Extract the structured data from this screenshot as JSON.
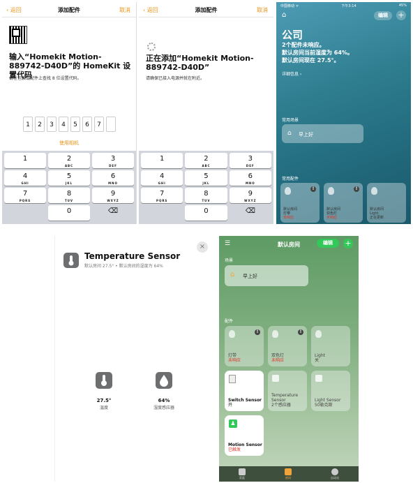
{
  "panel1": {
    "nav": {
      "back": "返回",
      "title": "添加配件",
      "cancel": "取消"
    },
    "heading": "输入“Homekit Motion-889742-D40D”的 HomeKit 设置代码",
    "hint": "请在包装或配件上查找 8 位设置代码。",
    "code_digits": [
      "1",
      "2",
      "3",
      "4",
      "5",
      "6",
      "7",
      ""
    ],
    "use_camera": "使用相机"
  },
  "panel2": {
    "nav": {
      "back": "返回",
      "title": "添加配件",
      "cancel": "取消"
    },
    "heading": "正在添加“Homekit Motion-889742-D40D”",
    "hint": "请确保已接入电源并就在附近。"
  },
  "keyboard": {
    "keys": [
      {
        "d": "1",
        "l": ""
      },
      {
        "d": "2",
        "l": "ABC"
      },
      {
        "d": "3",
        "l": "DEF"
      },
      {
        "d": "4",
        "l": "GHI"
      },
      {
        "d": "5",
        "l": "JKL"
      },
      {
        "d": "6",
        "l": "MNO"
      },
      {
        "d": "7",
        "l": "PQRS"
      },
      {
        "d": "8",
        "l": "TUV"
      },
      {
        "d": "9",
        "l": "WXYZ"
      },
      {
        "d": "",
        "l": ""
      },
      {
        "d": "0",
        "l": ""
      },
      {
        "d": "⌫",
        "l": ""
      }
    ]
  },
  "panel3": {
    "status": {
      "carrier": "中国移动 ᯤ",
      "time": "下午3:14",
      "battery": "45%"
    },
    "edit": "编辑",
    "home_name": "公司",
    "summary": [
      "2个配件未响应。",
      "默认房间当前湿度为 64%。",
      "默认房间现在 27.5°。"
    ],
    "details": "详细信息 ›",
    "scenes_label": "常用场景",
    "scene": "早上好",
    "accessories_label": "常用配件",
    "accessories": [
      {
        "room": "默认房间",
        "name": "灯带",
        "status": "未响应"
      },
      {
        "room": "默认房间",
        "name": "双色灯",
        "status": "未响应"
      },
      {
        "room": "默认房间",
        "name": "Light",
        "status": "正在更新"
      }
    ]
  },
  "panel4": {
    "title": "Temperature Sensor",
    "subtitle": "默认房间 27.5° • 默认房间的湿度为 64%",
    "readings": [
      {
        "value": "27.5°",
        "label": "温度"
      },
      {
        "value": "64%",
        "label": "湿度感应器"
      }
    ]
  },
  "panel5": {
    "title": "默认房间",
    "edit": "编辑",
    "scenes_label": "场景",
    "scene": "早上好",
    "accessories_label": "配件",
    "tiles": [
      {
        "name": "灯带",
        "status": "未响应"
      },
      {
        "name": "双色灯",
        "status": "未响应"
      },
      {
        "name": "Light",
        "status": "关"
      },
      {
        "name": "Switch Sensor",
        "status": "开"
      },
      {
        "name": "Temperature Sensor",
        "status": "2个感应器"
      },
      {
        "name": "Light Sensor",
        "status": "50勒克斯"
      },
      {
        "name": "Motion Sensor",
        "status": "已触发"
      }
    ],
    "tabs": [
      "家庭",
      "房间",
      "自动化"
    ]
  },
  "colors": {
    "accent": "#e8951b",
    "alert": "#e0342a",
    "edit_green": "#34c759"
  }
}
